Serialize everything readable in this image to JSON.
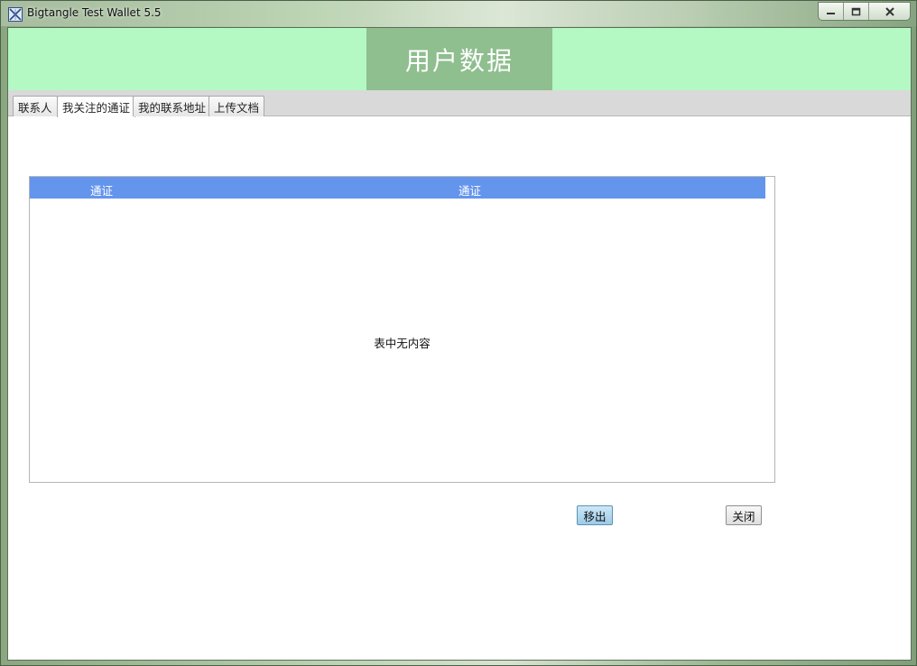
{
  "window": {
    "title": "Bigtangle Test Wallet 5.5",
    "controls": [
      "minimize-icon",
      "maximize-icon",
      "close-icon"
    ]
  },
  "header": {
    "title": "用户数据"
  },
  "tabs": [
    {
      "label": "联系人",
      "active": false
    },
    {
      "label": "我关注的通证",
      "active": true
    },
    {
      "label": "我的联系地址",
      "active": false
    },
    {
      "label": "上传文档",
      "active": false
    }
  ],
  "table": {
    "columns": [
      "通证",
      "通证"
    ],
    "rows": [],
    "empty_message": "表中无内容"
  },
  "actions": {
    "remove_label": "移出",
    "close_label": "关闭"
  },
  "colors": {
    "header_band": "#b4f8c4",
    "header_title_box": "#8fbe8f",
    "table_header": "#6495ed"
  }
}
